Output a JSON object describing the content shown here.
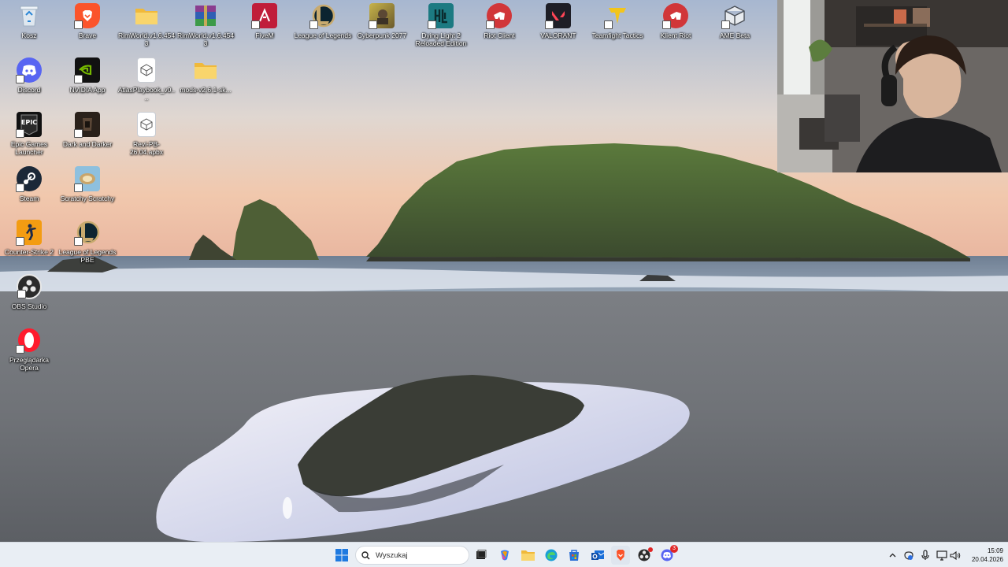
{
  "desktop": {
    "icons": [
      {
        "label": "Kosz",
        "icon": "recycle-bin-icon",
        "color": "#e8eef4"
      },
      {
        "label": "Brave",
        "icon": "brave-lion-icon",
        "color": "#fb542b"
      },
      {
        "label": "RimWorld.v1.6.4543",
        "icon": "folder-icon",
        "color": "#f5c542"
      },
      {
        "label": "RimWorld.v1.6.4543",
        "icon": "winrar-archive-icon",
        "color": "#7a3a8c"
      },
      {
        "label": "FiveM",
        "icon": "fivem-icon",
        "color": "#c01d3a"
      },
      {
        "label": "League of Legends",
        "icon": "league-of-legends-icon",
        "color": "#c8aa6e"
      },
      {
        "label": "Cyberpunk 2077",
        "icon": "cyberpunk-icon",
        "color": "#8a7a3c"
      },
      {
        "label": "Dying Light 2 Reloaded Edition",
        "icon": "dying-light-icon",
        "color": "#1c7a82"
      },
      {
        "label": "Riot Client",
        "icon": "riot-client-icon",
        "color": "#d13639"
      },
      {
        "label": "VALORANT",
        "icon": "valorant-icon",
        "color": "#fd4556"
      },
      {
        "label": "Teamfight Tactics",
        "icon": "tft-icon",
        "color": "#f3c51a"
      },
      {
        "label": "Klient Riot",
        "icon": "riot-client-icon",
        "color": "#d13639"
      },
      {
        "label": "AME Beta",
        "icon": "ame-cube-icon",
        "color": "#d0d4da"
      },
      {
        "label": "Discord",
        "icon": "discord-icon",
        "color": "#5865f2"
      },
      {
        "label": "NVIDIA App",
        "icon": "nvidia-icon",
        "color": "#111111"
      },
      {
        "label": "AtlasPlaybook_v0....",
        "icon": "apbx-file-icon",
        "color": "#ffffff"
      },
      {
        "label": "mods-v2.6.1-sk...",
        "icon": "folder-icon",
        "color": "#f5c542"
      },
      {
        "label": "Epic Games Launcher",
        "icon": "epic-games-icon",
        "color": "#111111"
      },
      {
        "label": "Dark and Darker",
        "icon": "dark-and-darker-icon",
        "color": "#3a2a1c"
      },
      {
        "label": "Revi-PB-26.04.apbx",
        "icon": "apbx-file-icon",
        "color": "#ffffff"
      },
      {
        "label": "Steam",
        "icon": "steam-icon",
        "color": "#1b2838"
      },
      {
        "label": "Scratchy Scratchy",
        "icon": "scratchy-icon",
        "color": "#7ab6d8"
      },
      {
        "label": "Counter-Strike 2",
        "icon": "counter-strike-icon",
        "color": "#f39c12"
      },
      {
        "label": "League of Legends PBE",
        "icon": "league-pbe-icon",
        "color": "#c8aa6e"
      },
      {
        "label": "OBS Studio",
        "icon": "obs-icon",
        "color": "#2b2b2b"
      },
      {
        "label": "Przeglądarka Opera",
        "icon": "opera-icon",
        "color": "#ff1b2d"
      }
    ]
  },
  "taskbar": {
    "search_placeholder": "Wyszukaj",
    "apps": [
      {
        "name": "start-button",
        "icon": "windows-logo-icon"
      },
      {
        "name": "task-view-button",
        "icon": "task-view-icon"
      },
      {
        "name": "copilot-button",
        "icon": "copilot-icon"
      },
      {
        "name": "file-explorer-button",
        "icon": "folder-icon"
      },
      {
        "name": "edge-button",
        "icon": "edge-icon"
      },
      {
        "name": "store-button",
        "icon": "store-icon"
      },
      {
        "name": "outlook-button",
        "icon": "mail-icon"
      },
      {
        "name": "brave-taskbar-button",
        "icon": "brave-lion-icon"
      },
      {
        "name": "obs-taskbar-button",
        "icon": "obs-icon"
      },
      {
        "name": "discord-taskbar-button",
        "icon": "discord-icon"
      }
    ],
    "discord_badge": "3",
    "tray": {
      "chevron": "chevron-up-icon",
      "icons": [
        "vpn-shield-icon",
        "microphone-icon",
        "display-icon",
        "speaker-icon"
      ]
    },
    "clock": {
      "time": "15:09",
      "date": "20.04.2026"
    }
  }
}
